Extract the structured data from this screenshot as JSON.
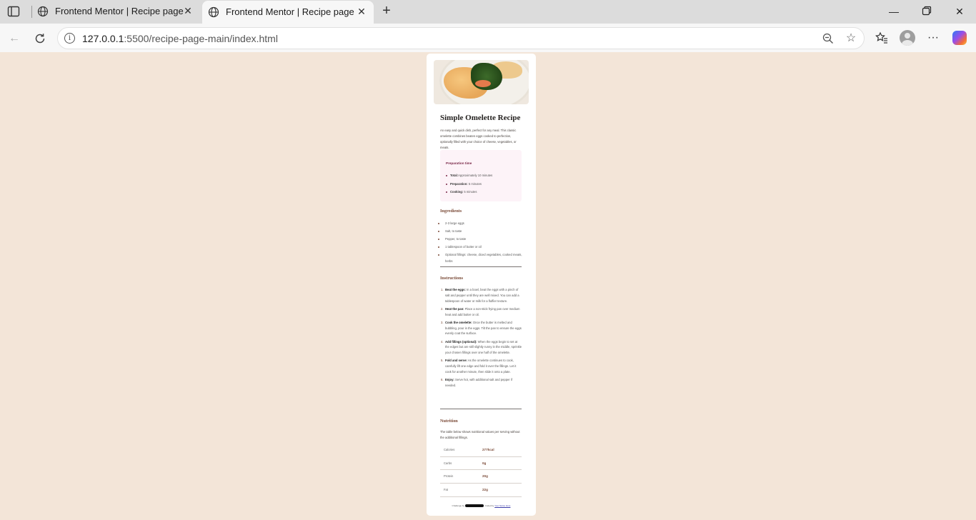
{
  "browser": {
    "tabs": [
      {
        "title": "Frontend Mentor | Recipe page",
        "active": false
      },
      {
        "title": "Frontend Mentor | Recipe page",
        "active": true
      }
    ],
    "url_host": "127.0.0.1",
    "url_rest": ":5500/recipe-page-main/index.html"
  },
  "recipe": {
    "title": "Simple Omelette Recipe",
    "intro": "An easy and quick dish, perfect for any meal. This classic omelette combines beaten eggs cooked to perfection, optionally filled with your choice of cheese, vegetables, or meats.",
    "prep": {
      "heading": "Preparation time",
      "items": [
        {
          "label": "Total:",
          "value": "Approximately 10 minutes"
        },
        {
          "label": "Preparation:",
          "value": " 5 minutes"
        },
        {
          "label": "Cooking:",
          "value": " 5 minutes"
        }
      ]
    },
    "ingredients_heading": "Ingredients",
    "ingredients": [
      "2-3 large eggs",
      "Salt, to taste",
      "Pepper, to taste",
      "1 tablespoon of butter or oil",
      "Optional fillings: cheese, diced vegetables, cooked meats, herbs"
    ],
    "instructions_heading": "Instructions",
    "instructions": [
      {
        "label": "Beat the eggs:",
        "text": " In a bowl, beat the eggs with a pinch of salt and pepper until they are well mixed. You can add a tablespoon of water or milk for a fluffier texture."
      },
      {
        "label": "Heat the pan:",
        "text": " Place a non-stick frying pan over medium heat and add butter or oil."
      },
      {
        "label": "Cook the omelette:",
        "text": " Once the butter is melted and bubbling, pour in the eggs. Tilt the pan to ensure the eggs evenly coat the surface."
      },
      {
        "label": "Add fillings (optional):",
        "text": " When the eggs begin to set at the edges but are still slightly runny in the middle, sprinkle your chosen fillings over one half of the omelette."
      },
      {
        "label": "Fold and serve:",
        "text": " As the omelette continues to cook, carefully lift one edge and fold it over the fillings. Let it cook for another minute, then slide it onto a plate."
      },
      {
        "label": "Enjoy:",
        "text": " Serve hot, with additional salt and pepper if needed."
      }
    ],
    "nutrition_heading": "Nutrition",
    "nutrition_intro": "The table below shows nutritional values per serving without the additional fillings.",
    "nutrition": [
      {
        "name": "Calories",
        "value": "277kcal"
      },
      {
        "name": "Carbs",
        "value": "0g"
      },
      {
        "name": "Protein",
        "value": "20g"
      },
      {
        "name": "Fat",
        "value": "22g"
      }
    ],
    "attribution": {
      "prefix": "Challenge by",
      "mid": ". Coded by",
      "link": "Your Name Here"
    }
  },
  "colors": {
    "page_bg": "#f3e5d8",
    "accent_brown": "#7b4b38",
    "accent_rose": "#7a2848",
    "prep_bg": "#fdf3f8"
  }
}
